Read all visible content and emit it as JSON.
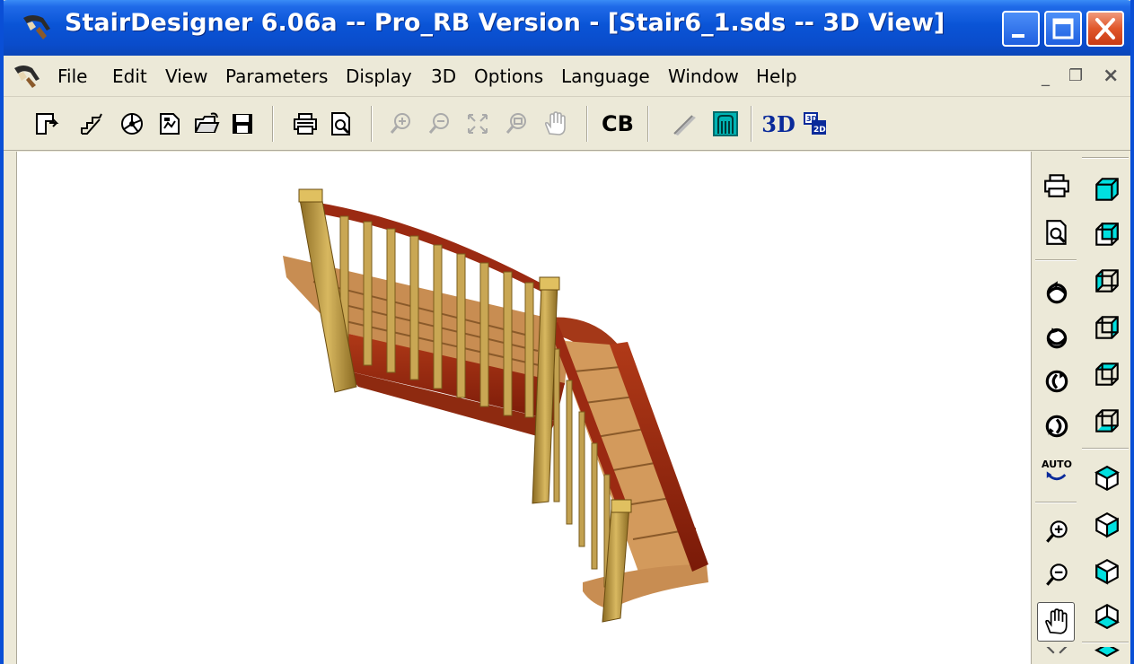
{
  "window": {
    "title": "StairDesigner 6.06a -- Pro_RB Version - [Stair6_1.sds -- 3D View]",
    "colors": {
      "titlebar": "#0a54d6",
      "close": "#e0562a",
      "face": "#ece9d8",
      "wood_light": "#c9934f",
      "wood_dark": "#9b2a12"
    }
  },
  "menu": {
    "items": [
      "File",
      "Edit",
      "View",
      "Parameters",
      "Display",
      "3D",
      "Options",
      "Language",
      "Window",
      "Help"
    ]
  },
  "mdi": {
    "minimize": "_",
    "restore": "❐",
    "close": "×"
  },
  "toolbar": {
    "cb_label": "CB",
    "three_d_label": "3D",
    "icons": [
      "new-stair-icon",
      "straight-stair-icon",
      "spiral-stair-icon",
      "open-template-icon",
      "open-folder-icon",
      "save-icon",
      "print-icon",
      "print-preview-icon",
      "zoom-in-icon",
      "zoom-out-icon",
      "zoom-extents-icon",
      "zoom-window-icon",
      "pan-hand-icon",
      "stringer-icon",
      "balustrade-icon",
      "view-3d-icon",
      "view-2d-icon"
    ]
  },
  "right_toolbar": {
    "auto_label": "AUTO",
    "icons": [
      "print-icon",
      "print-preview-icon",
      "rotate-up-icon",
      "rotate-down-icon",
      "rotate-left-icon",
      "rotate-right-icon",
      "auto-rotate-icon",
      "zoom-in-icon",
      "zoom-out-icon",
      "pan-hand-icon",
      "view-cube-icons"
    ]
  }
}
